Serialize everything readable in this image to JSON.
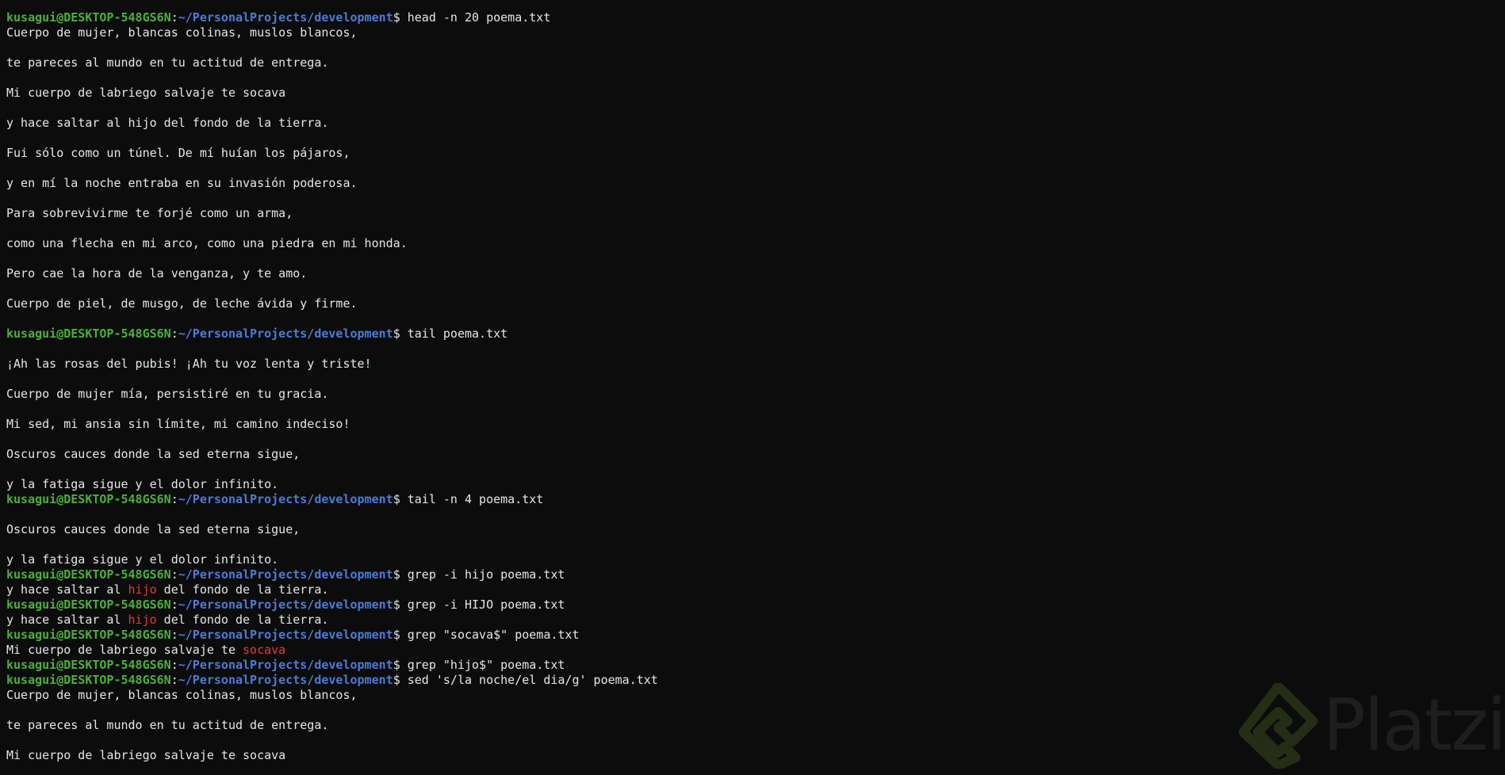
{
  "prompt": {
    "user": "kusagui@DESKTOP-548GS6N",
    "separator": ":",
    "path": "~/PersonalProjects/development",
    "symbol": "$"
  },
  "lines": [
    {
      "type": "prompt",
      "cmd": " head -n 20 poema.txt"
    },
    {
      "type": "text",
      "text": "Cuerpo de mujer, blancas colinas, muslos blancos,"
    },
    {
      "type": "text",
      "text": ""
    },
    {
      "type": "text",
      "text": "te pareces al mundo en tu actitud de entrega."
    },
    {
      "type": "text",
      "text": ""
    },
    {
      "type": "text",
      "text": "Mi cuerpo de labriego salvaje te socava"
    },
    {
      "type": "text",
      "text": ""
    },
    {
      "type": "text",
      "text": "y hace saltar al hijo del fondo de la tierra."
    },
    {
      "type": "text",
      "text": ""
    },
    {
      "type": "text",
      "text": "Fui sólo como un túnel. De mí huían los pájaros,"
    },
    {
      "type": "text",
      "text": ""
    },
    {
      "type": "text",
      "text": "y en mí la noche entraba en su invasión poderosa."
    },
    {
      "type": "text",
      "text": ""
    },
    {
      "type": "text",
      "text": "Para sobrevivirme te forjé como un arma,"
    },
    {
      "type": "text",
      "text": ""
    },
    {
      "type": "text",
      "text": "como una flecha en mi arco, como una piedra en mi honda."
    },
    {
      "type": "text",
      "text": ""
    },
    {
      "type": "text",
      "text": "Pero cae la hora de la venganza, y te amo."
    },
    {
      "type": "text",
      "text": ""
    },
    {
      "type": "text",
      "text": "Cuerpo de piel, de musgo, de leche ávida y firme."
    },
    {
      "type": "text",
      "text": ""
    },
    {
      "type": "prompt",
      "cmd": " tail poema.txt"
    },
    {
      "type": "text",
      "text": ""
    },
    {
      "type": "text",
      "text": "¡Ah las rosas del pubis! ¡Ah tu voz lenta y triste!"
    },
    {
      "type": "text",
      "text": ""
    },
    {
      "type": "text",
      "text": "Cuerpo de mujer mía, persistiré en tu gracia."
    },
    {
      "type": "text",
      "text": ""
    },
    {
      "type": "text",
      "text": "Mi sed, mi ansia sin límite, mi camino indeciso!"
    },
    {
      "type": "text",
      "text": ""
    },
    {
      "type": "text",
      "text": "Oscuros cauces donde la sed eterna sigue,"
    },
    {
      "type": "text",
      "text": ""
    },
    {
      "type": "text",
      "text": "y la fatiga sigue y el dolor infinito."
    },
    {
      "type": "prompt",
      "cmd": " tail -n 4 poema.txt"
    },
    {
      "type": "text",
      "text": ""
    },
    {
      "type": "text",
      "text": "Oscuros cauces donde la sed eterna sigue,"
    },
    {
      "type": "text",
      "text": ""
    },
    {
      "type": "text",
      "text": "y la fatiga sigue y el dolor infinito."
    },
    {
      "type": "prompt",
      "cmd": " grep -i hijo poema.txt"
    },
    {
      "type": "match",
      "before": "y hace saltar al ",
      "match": "hijo",
      "after": " del fondo de la tierra."
    },
    {
      "type": "prompt",
      "cmd": " grep -i HIJO poema.txt"
    },
    {
      "type": "match",
      "before": "y hace saltar al ",
      "match": "hijo",
      "after": " del fondo de la tierra."
    },
    {
      "type": "prompt",
      "cmd": " grep \"socava$\" poema.txt"
    },
    {
      "type": "match",
      "before": "Mi cuerpo de labriego salvaje te ",
      "match": "socava",
      "after": ""
    },
    {
      "type": "prompt",
      "cmd": " grep \"hijo$\" poema.txt"
    },
    {
      "type": "prompt",
      "cmd": " sed 's/la noche/el dia/g' poema.txt"
    },
    {
      "type": "text",
      "text": "Cuerpo de mujer, blancas colinas, muslos blancos,"
    },
    {
      "type": "text",
      "text": ""
    },
    {
      "type": "text",
      "text": "te pareces al mundo en tu actitud de entrega."
    },
    {
      "type": "text",
      "text": ""
    },
    {
      "type": "text",
      "text": "Mi cuerpo de labriego salvaje te socava"
    }
  ],
  "watermark": {
    "text": "Platzi",
    "icon": "platzi-logo-icon"
  },
  "colors": {
    "background": "#0c0c0c",
    "text": "#e6e6e6",
    "user": "#4caf3b",
    "path": "#4b7bd9",
    "match": "#e33a3a"
  }
}
